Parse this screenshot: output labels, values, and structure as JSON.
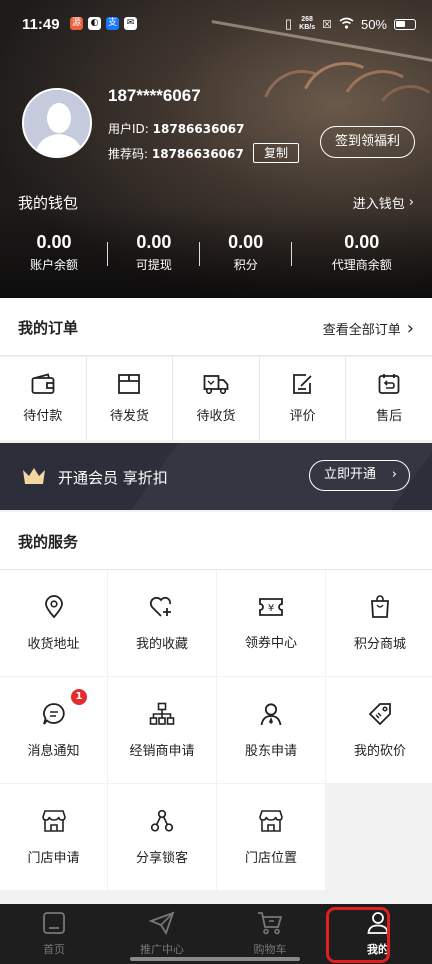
{
  "status_bar": {
    "time": "11:49",
    "net_speed_value": "268",
    "net_speed_unit": "KB/s",
    "battery": "50%",
    "icons": [
      "vibrate-icon",
      "x-icon",
      "wifi-icon",
      "battery-icon"
    ]
  },
  "profile": {
    "phone": "187****6067",
    "user_id_label": "用户ID:",
    "user_id": "18786636067",
    "referral_label": "推荐码:",
    "referral_code": "18786636067",
    "copy_label": "复制",
    "checkin_label": "签到领福利"
  },
  "wallet": {
    "title": "我的钱包",
    "link": "进入钱包",
    "items": [
      {
        "value": "0.00",
        "label": "账户余额"
      },
      {
        "value": "0.00",
        "label": "可提现"
      },
      {
        "value": "0.00",
        "label": "积分"
      },
      {
        "value": "0.00",
        "label": "代理商余额"
      }
    ]
  },
  "orders": {
    "title": "我的订单",
    "link": "查看全部订单",
    "items": [
      {
        "label": "待付款",
        "icon": "wallet-icon"
      },
      {
        "label": "待发货",
        "icon": "package-icon"
      },
      {
        "label": "待收货",
        "icon": "truck-icon"
      },
      {
        "label": "评价",
        "icon": "review-icon"
      },
      {
        "label": "售后",
        "icon": "return-icon"
      }
    ]
  },
  "vip": {
    "text": "开通会员 享折扣",
    "button": "立即开通",
    "accent": "#f3d6a0"
  },
  "services": {
    "title": "我的服务",
    "items": [
      {
        "label": "收货地址",
        "icon": "location-icon"
      },
      {
        "label": "我的收藏",
        "icon": "favorite-icon"
      },
      {
        "label": "领券中心",
        "icon": "coupon-icon"
      },
      {
        "label": "积分商城",
        "icon": "shopping-bag-icon"
      },
      {
        "label": "消息通知",
        "icon": "message-icon",
        "badge": "1"
      },
      {
        "label": "经销商申请",
        "icon": "org-chart-icon"
      },
      {
        "label": "股东申请",
        "icon": "person-icon"
      },
      {
        "label": "我的砍价",
        "icon": "price-tag-icon"
      },
      {
        "label": "门店申请",
        "icon": "store-icon"
      },
      {
        "label": "分享锁客",
        "icon": "share-icon"
      },
      {
        "label": "门店位置",
        "icon": "store-location-icon"
      }
    ]
  },
  "tabbar": {
    "items": [
      {
        "label": "首页",
        "icon": "home-icon"
      },
      {
        "label": "推广中心",
        "icon": "send-icon"
      },
      {
        "label": "购物车",
        "icon": "cart-icon"
      },
      {
        "label": "我的",
        "icon": "user-icon",
        "active": true
      }
    ],
    "highlight_color": "#e02020"
  }
}
